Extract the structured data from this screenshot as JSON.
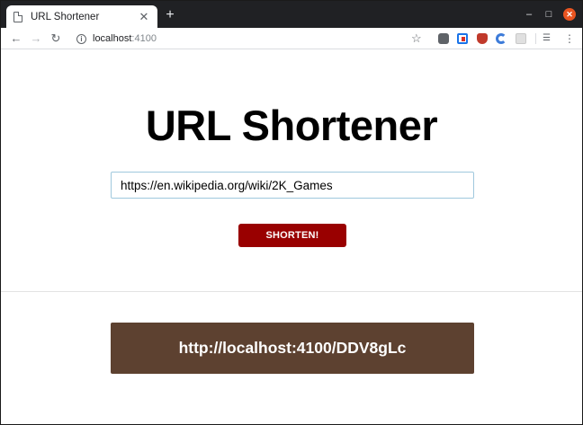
{
  "browser": {
    "tab": {
      "title": "URL Shortener",
      "close_icon": "close-icon",
      "favicon": "document-icon"
    },
    "new_tab_glyph": "+",
    "window_controls": {
      "minimize": "–",
      "maximize": "□",
      "close": "✕"
    },
    "toolbar": {
      "back_glyph": "←",
      "forward_glyph": "→",
      "reload_glyph": "↻",
      "info_glyph": "i",
      "url_host": "localhost",
      "url_port": ":4100",
      "bookmark_glyph": "☆",
      "tabs_ext_glyph": "☰",
      "menu_glyph": "⋮"
    }
  },
  "page": {
    "title": "URL Shortener",
    "input": {
      "value": "https://en.wikipedia.org/wiki/2K_Games"
    },
    "button_label": "SHORTEN!",
    "result_url": "http://localhost:4100/DDV8gLc"
  },
  "colors": {
    "button_bg": "#990000",
    "result_bg": "#5d4130",
    "input_border": "#9fc8dd",
    "tab_bar": "#202124",
    "window_close": "#e95420"
  }
}
